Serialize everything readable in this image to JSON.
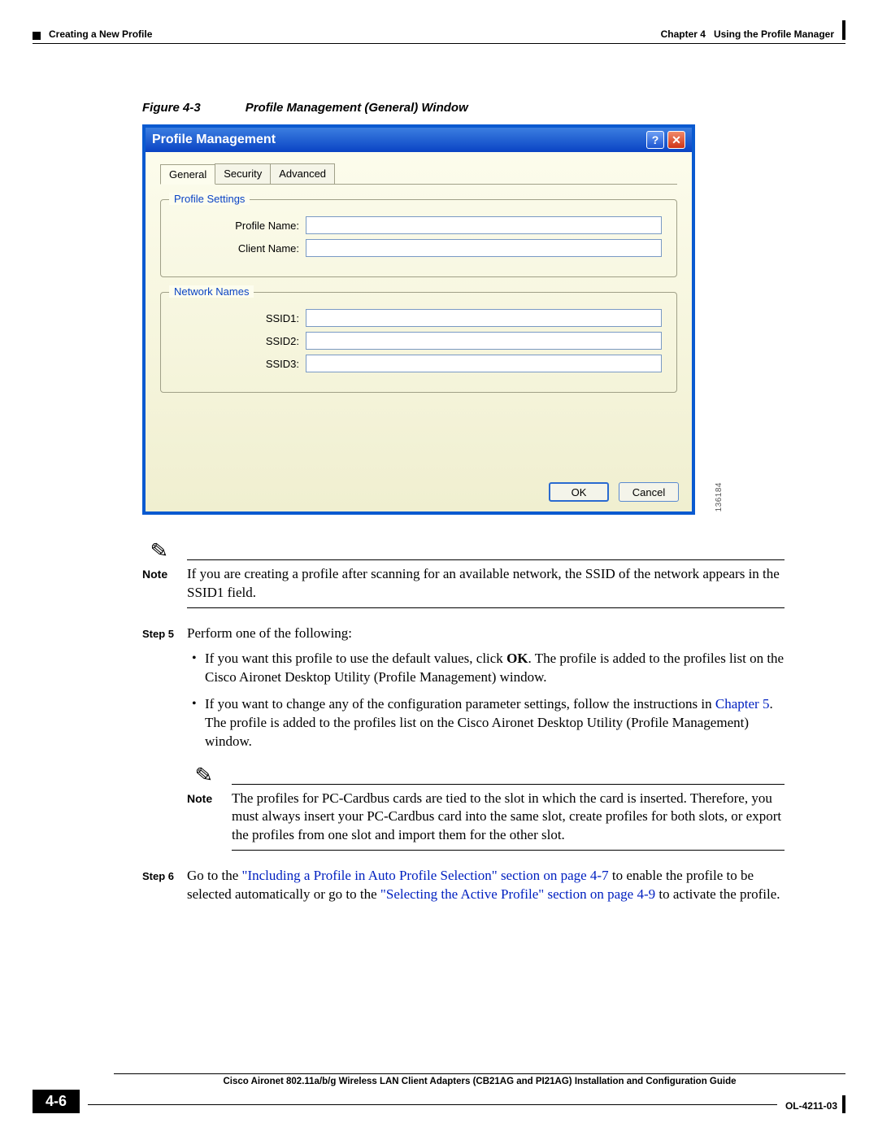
{
  "header": {
    "section": "Creating a New Profile",
    "chapter_label": "Chapter 4",
    "chapter_title": "Using the Profile Manager"
  },
  "figure": {
    "label": "Figure 4-3",
    "caption": "Profile Management (General) Window"
  },
  "dialog": {
    "title": "Profile Management",
    "help_glyph": "?",
    "close_glyph": "✕",
    "tabs": {
      "general": "General",
      "security": "Security",
      "advanced": "Advanced"
    },
    "group_profile": {
      "legend": "Profile Settings",
      "profile_name_label": "Profile Name:",
      "profile_name_value": "",
      "client_name_label": "Client Name:",
      "client_name_value": ""
    },
    "group_network": {
      "legend": "Network Names",
      "ssid1_label": "SSID1:",
      "ssid1_value": "",
      "ssid2_label": "SSID2:",
      "ssid2_value": "",
      "ssid3_label": "SSID3:",
      "ssid3_value": ""
    },
    "ok_label": "OK",
    "cancel_label": "Cancel",
    "image_id": "136184"
  },
  "notes": {
    "label": "Note",
    "note1": "If you are creating a profile after scanning for an available network, the SSID of the network appears in the SSID1 field.",
    "note2": "The profiles for PC-Cardbus cards are tied to the slot in which the card is inserted. Therefore, you must always insert your PC-Cardbus card into the same slot, create profiles for both slots, or export the profiles from one slot and import them for the other slot."
  },
  "steps": {
    "step5_label": "Step 5",
    "step5_intro": "Perform one of the following:",
    "step5_bullet1_a": "If you want this profile to use the default values, click ",
    "step5_bullet1_ok": "OK",
    "step5_bullet1_b": ". The profile is added to the profiles list on the Cisco Aironet Desktop Utility (Profile Management) window.",
    "step5_bullet2_a": "If you want to change any of the configuration parameter settings, follow the instructions in ",
    "step5_bullet2_link": "Chapter 5",
    "step5_bullet2_b": ". The profile is added to the profiles list on the Cisco Aironet Desktop Utility (Profile Management) window.",
    "step6_label": "Step 6",
    "step6_a": "Go to the ",
    "step6_link1": "\"Including a Profile in Auto Profile Selection\" section on page 4-7",
    "step6_b": " to enable the profile to be selected automatically or go to the ",
    "step6_link2": "\"Selecting the Active Profile\" section on page 4-9",
    "step6_c": " to activate the profile."
  },
  "footer": {
    "guide_title": "Cisco Aironet 802.11a/b/g Wireless LAN Client Adapters (CB21AG and PI21AG) Installation and Configuration Guide",
    "page_num": "4-6",
    "doc_id": "OL-4211-03"
  }
}
